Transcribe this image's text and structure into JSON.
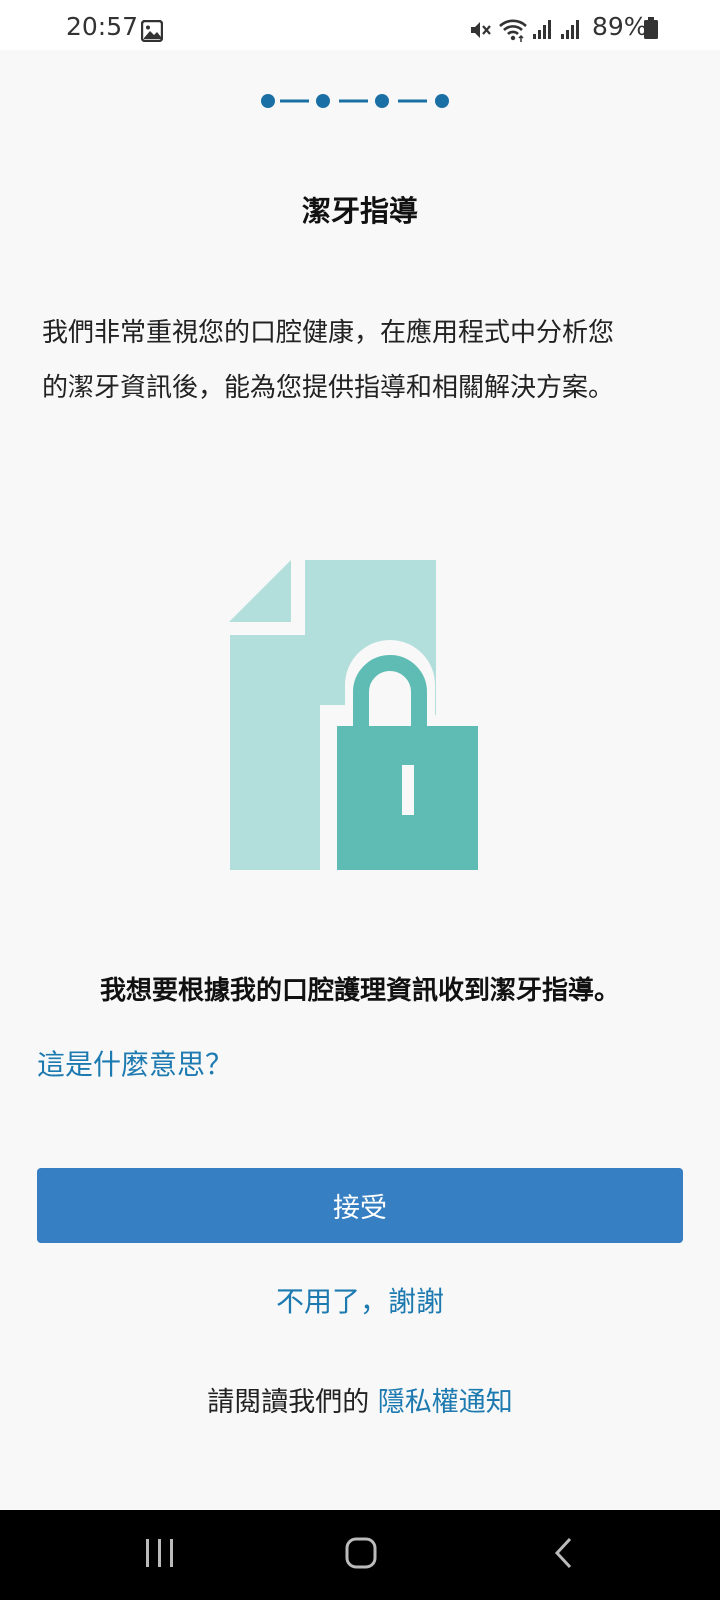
{
  "status_bar": {
    "time": "20:57",
    "battery": "89%",
    "icons": [
      "gallery-icon",
      "mute-icon",
      "wifi-icon",
      "signal-icon",
      "signal-icon",
      "battery-icon"
    ]
  },
  "stepper": {
    "total_steps": 4,
    "color": "#1a6fa5"
  },
  "title": "潔牙指導",
  "intro": {
    "line1": "我們非常重視您的口腔健康，在應用程式中分析您",
    "line2": "的潔牙資訊後，能為您提供指導和相關解決方案。"
  },
  "illustration": {
    "icon": "document-lock-icon",
    "doc_color": "#b2dfdb",
    "lock_color": "#5fbcb4"
  },
  "consent": {
    "heading": "我想要根據我的口腔護理資訊收到潔牙指導。",
    "what_link": "這是什麼意思？"
  },
  "buttons": {
    "accept": "接受",
    "decline": "不用了，謝謝"
  },
  "privacy": {
    "prefix": "請閱讀我們的",
    "link": "隱私權通知"
  },
  "nav_bar": {
    "icons": [
      "recents-icon",
      "home-icon",
      "back-icon"
    ]
  },
  "colors": {
    "accent_blue": "#367fc2",
    "link_blue": "#1d7ab0",
    "background": "#f8f8f8"
  }
}
